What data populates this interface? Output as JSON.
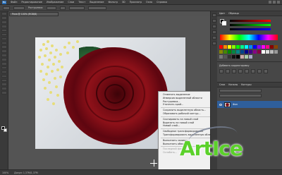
{
  "app": {
    "logo": "Ps",
    "menu": [
      "Файл",
      "Редактирование",
      "Изображение",
      "Слои",
      "Текст",
      "Выделение",
      "Фильтр",
      "3D",
      "Просмотр",
      "Окно",
      "Справка"
    ]
  },
  "options_bar": {
    "feather_label": "Растушевка:",
    "feather_value": "0 пикс",
    "refine_label": "Уточн. край..."
  },
  "document": {
    "tab_title": "Роза @ 100% (RGB/8)",
    "caption": "photo.rose.ru"
  },
  "context_menu": {
    "groups": [
      [
        "Отменить выделение",
        "Инверсия выделенной области",
        "Растушевка...",
        "Уточнить край..."
      ],
      [
        "Сохранить выделенную область...",
        "Образовать рабочий контур..."
      ],
      [
        "Скопировать на новый слой",
        "Вырезать на новый слой",
        "Новый слой..."
      ],
      [
        "Свободное трансформирование",
        "Трансформировать выделенную область"
      ],
      [
        "Выполнить заливку...",
        "Выполнить обводку..."
      ],
      [
        "Последний фильтр",
        "Ослабить..."
      ]
    ],
    "disabled": [
      "Последний фильтр",
      "Ослабить..."
    ]
  },
  "status_bar": {
    "zoom": "100%",
    "doc_info": "Докум: 1,37M/1,37M"
  },
  "panels": {
    "color_tabs": [
      "Цвет",
      "Образцы"
    ],
    "adjust_title": "Добавить корректировку",
    "layers_tabs": [
      "Слои",
      "Каналы",
      "Контуры"
    ],
    "layer_name": "Фон"
  },
  "watermark": {
    "text": "ArtIce"
  },
  "colors": {
    "accent": "#2f5f9c",
    "watermark_green": "#5bd12a",
    "rose": "#8e1119"
  }
}
